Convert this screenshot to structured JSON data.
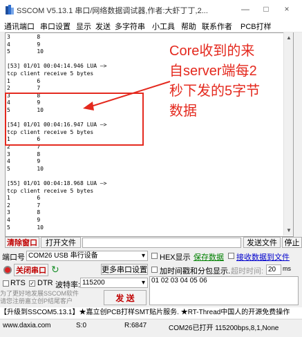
{
  "window": {
    "title": "SSCOM V5.13.1 串口/网络数据调试器,作者:大虾丁丁,2...",
    "min": "—",
    "max": "□",
    "close": "×"
  },
  "menu": [
    "通讯端口",
    "串口设置",
    "显示",
    "发送",
    "多字符串",
    "小工具",
    "帮助",
    "联系作者",
    "PCB打样"
  ],
  "log_lines": [
    "3        8",
    "4        9",
    "5        10",
    "",
    "[53] 01/01 00:04:14.946 LUA —>",
    "tcp client receive 5 bytes",
    "1        6",
    "2        7",
    "3        8",
    "4        9",
    "5        10",
    "",
    "[54] 01/01 00:04:16.947 LUA —>",
    "tcp client receive 5 bytes",
    "1        6",
    "2        7",
    "3        8",
    "4        9",
    "5        10",
    "",
    "[55] 01/01 00:04:18.968 LUA —>",
    "tcp client receive 5 bytes",
    "1        6",
    "2        7",
    "3        8",
    "4        9",
    "5        10"
  ],
  "annotation": [
    "Core收到的来",
    "自server端每2",
    "秒下发的5字节",
    "数据"
  ],
  "buttons": {
    "clear_window": "清除窗口",
    "open_file": "打开文件",
    "send_file": "发送文件",
    "stop": "停止"
  },
  "port": {
    "label": "端口号",
    "value": "COM26 USB 串行设备",
    "more_settings": "更多串口设置",
    "open_port": "关闭串口"
  },
  "options": {
    "hex_display": "HEX显示",
    "save_data": "保存数据",
    "recv_to_file": "接收数据到文件",
    "add_timestamp": "加时间戳和分包显示.",
    "timeout_label": "超时时间:",
    "timeout_value": "20",
    "timeout_unit": "ms",
    "rts": "RTS",
    "dtr": "DTR",
    "baud_label": "波特率:",
    "baud_value": "115200",
    "send_data": "01 02 03 04 05 06",
    "send_btn": "发 送"
  },
  "hint": [
    "为了更好地发展SSCOM软件",
    "请您注册嘉立创P结尾客户"
  ],
  "promo": "【升级到SSCOM5.13.1】★嘉立创PCB打样SMT贴片服务. ★RT-Thread中国人的开源免费操作",
  "status": {
    "site": "www.daxia.com",
    "s": "S:0",
    "r": "R:6847",
    "port": "COM26已打开 115200bps,8,1,None"
  },
  "colors": {
    "accent": "#e4291e",
    "clear_btn": "#c00000",
    "save_green": "#008000",
    "link_blue": "#0000cc"
  }
}
